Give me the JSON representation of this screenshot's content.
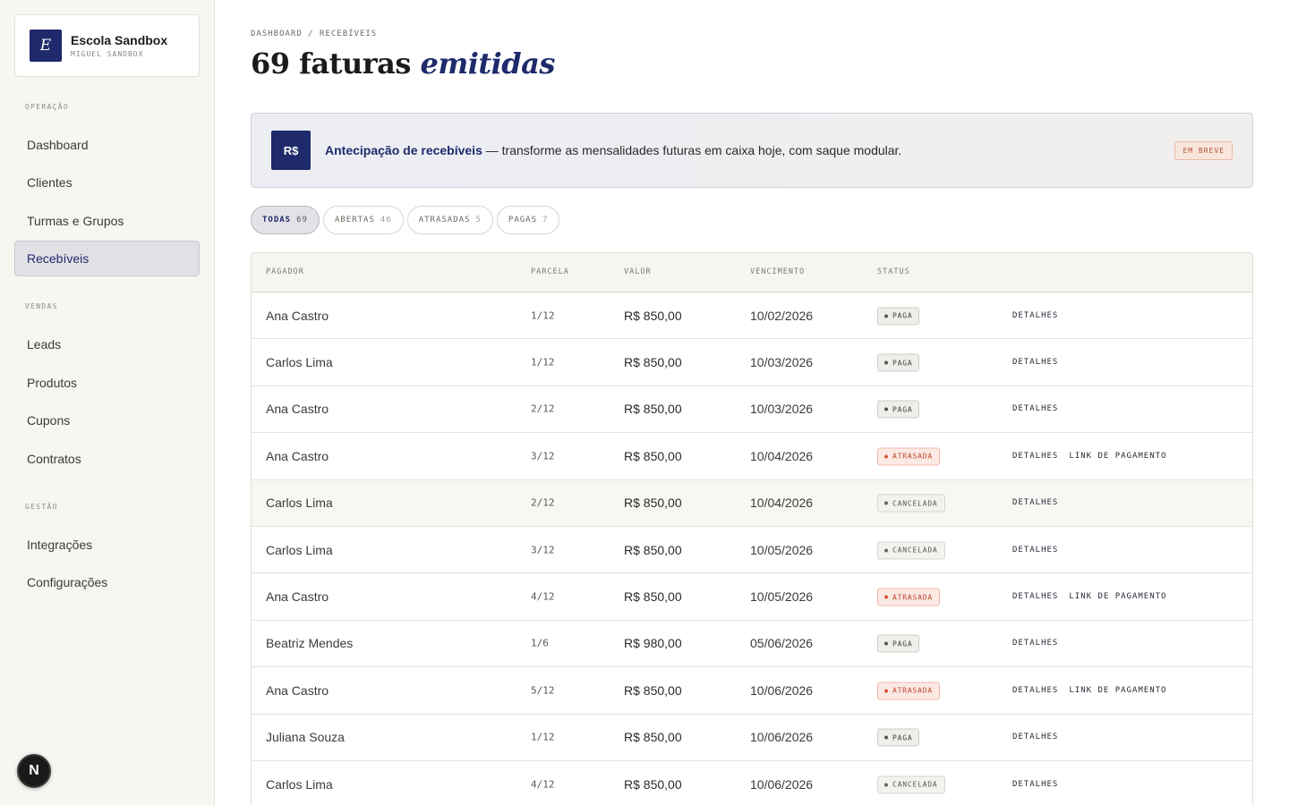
{
  "brand": {
    "logo_letter": "E",
    "name": "Escola Sandbox",
    "user": "MIGUEL SANDBOX"
  },
  "sidebar": {
    "sections": [
      {
        "label": "OPERAÇÃO",
        "items": [
          "Dashboard",
          "Clientes",
          "Turmas e Grupos",
          "Recebíveis"
        ]
      },
      {
        "label": "VENDAS",
        "items": [
          "Leads",
          "Produtos",
          "Cupons",
          "Contratos"
        ]
      },
      {
        "label": "GESTÃO",
        "items": [
          "Integrações",
          "Configurações"
        ]
      }
    ],
    "active_item": "Recebíveis"
  },
  "next_badge": "N",
  "breadcrumb": "DASHBOARD / RECEBÍVEIS",
  "title": {
    "main": "69 faturas",
    "emphasis": "emitidas"
  },
  "banner": {
    "icon": "R$",
    "highlight": "Antecipação de recebíveis",
    "text": " — transforme as mensalidades futuras em caixa hoje, com saque modular.",
    "badge": "EM BREVE"
  },
  "filters": [
    {
      "label": "TODAS",
      "count": "69",
      "active": true
    },
    {
      "label": "ABERTAS",
      "count": "46",
      "active": false
    },
    {
      "label": "ATRASADAS",
      "count": "5",
      "active": false
    },
    {
      "label": "PAGAS",
      "count": "7",
      "active": false
    }
  ],
  "table": {
    "headers": [
      "PAGADOR",
      "PARCELA",
      "VALOR",
      "VENCIMENTO",
      "STATUS"
    ],
    "rows": [
      {
        "pagador": "Ana Castro",
        "parcela": "1/12",
        "valor": "R$ 850,00",
        "vencimento": "10/02/2026",
        "status": "PAGA",
        "actions": [
          "DETALHES"
        ]
      },
      {
        "pagador": "Carlos Lima",
        "parcela": "1/12",
        "valor": "R$ 850,00",
        "vencimento": "10/03/2026",
        "status": "PAGA",
        "actions": [
          "DETALHES"
        ]
      },
      {
        "pagador": "Ana Castro",
        "parcela": "2/12",
        "valor": "R$ 850,00",
        "vencimento": "10/03/2026",
        "status": "PAGA",
        "actions": [
          "DETALHES"
        ]
      },
      {
        "pagador": "Ana Castro",
        "parcela": "3/12",
        "valor": "R$ 850,00",
        "vencimento": "10/04/2026",
        "status": "ATRASADA",
        "actions": [
          "DETALHES",
          "LINK DE PAGAMENTO"
        ]
      },
      {
        "pagador": "Carlos Lima",
        "parcela": "2/12",
        "valor": "R$ 850,00",
        "vencimento": "10/04/2026",
        "status": "CANCELADA",
        "actions": [
          "DETALHES"
        ],
        "hover": true
      },
      {
        "pagador": "Carlos Lima",
        "parcela": "3/12",
        "valor": "R$ 850,00",
        "vencimento": "10/05/2026",
        "status": "CANCELADA",
        "actions": [
          "DETALHES"
        ]
      },
      {
        "pagador": "Ana Castro",
        "parcela": "4/12",
        "valor": "R$ 850,00",
        "vencimento": "10/05/2026",
        "status": "ATRASADA",
        "actions": [
          "DETALHES",
          "LINK DE PAGAMENTO"
        ]
      },
      {
        "pagador": "Beatriz Mendes",
        "parcela": "1/6",
        "valor": "R$ 980,00",
        "vencimento": "05/06/2026",
        "status": "PAGA",
        "actions": [
          "DETALHES"
        ]
      },
      {
        "pagador": "Ana Castro",
        "parcela": "5/12",
        "valor": "R$ 850,00",
        "vencimento": "10/06/2026",
        "status": "ATRASADA",
        "actions": [
          "DETALHES",
          "LINK DE PAGAMENTO"
        ]
      },
      {
        "pagador": "Juliana Souza",
        "parcela": "1/12",
        "valor": "R$ 850,00",
        "vencimento": "10/06/2026",
        "status": "PAGA",
        "actions": [
          "DETALHES"
        ]
      },
      {
        "pagador": "Carlos Lima",
        "parcela": "4/12",
        "valor": "R$ 850,00",
        "vencimento": "10/06/2026",
        "status": "CANCELADA",
        "actions": [
          "DETALHES"
        ]
      }
    ]
  },
  "colors": {
    "accent": "#1e2a6b",
    "late": "#c0452b",
    "sidebar_bg": "#f7f6f1"
  }
}
